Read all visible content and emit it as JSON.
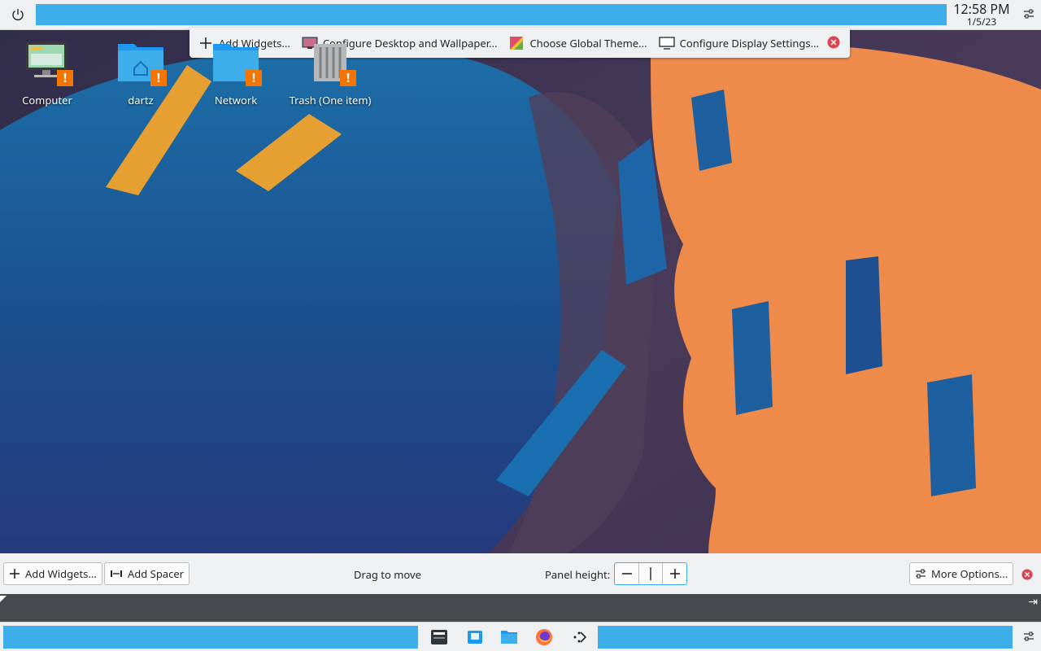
{
  "clock": {
    "time": "12:58 PM",
    "date": "1/5/23"
  },
  "toolbox": {
    "items": [
      {
        "label": "Add Widgets...",
        "icon": "plus-icon"
      },
      {
        "label": "Configure Desktop and Wallpaper...",
        "icon": "wallpaper-icon"
      },
      {
        "label": "Choose Global Theme...",
        "icon": "theme-icon"
      },
      {
        "label": "Configure Display Settings...",
        "icon": "display-icon"
      }
    ]
  },
  "desktop_icons": [
    {
      "label": "Computer",
      "icon": "computer-icon"
    },
    {
      "label": "dartz",
      "icon": "home-folder-icon"
    },
    {
      "label": "Network",
      "icon": "network-folder-icon"
    },
    {
      "label": "Trash (One item)",
      "icon": "trash-icon"
    }
  ],
  "edit_bar": {
    "add_widgets": "Add Widgets...",
    "add_spacer": "Add Spacer",
    "drag": "Drag to move",
    "panel_height_label": "Panel height:",
    "more_options": "More Options..."
  },
  "colors": {
    "accent": "#3daee9",
    "panel": "#eff0f1",
    "warning": "#f67400",
    "close": "#da4453"
  }
}
